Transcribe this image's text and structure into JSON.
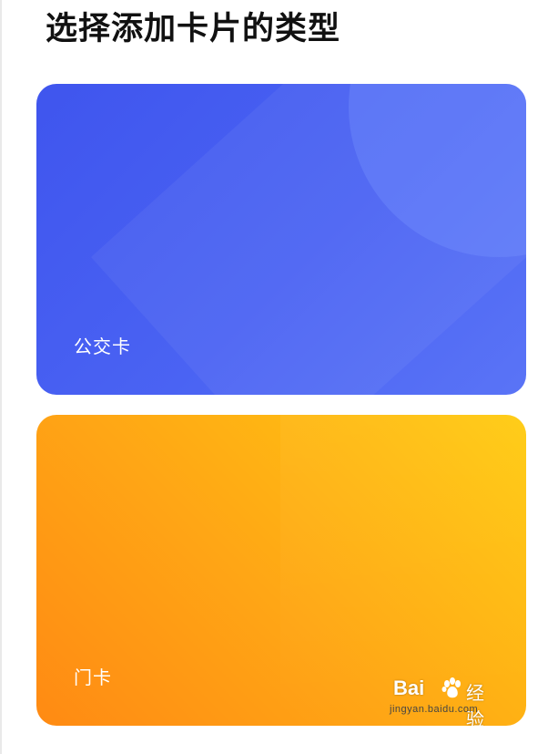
{
  "page": {
    "title": "选择添加卡片的类型"
  },
  "cards": [
    {
      "id": "transit",
      "label": "公交卡",
      "gradient_start": "#3f55ee",
      "gradient_end": "#5a74f6"
    },
    {
      "id": "door",
      "label": "门卡",
      "gradient_start": "#ff8a13",
      "gradient_end": "#ffcb10"
    }
  ],
  "watermark": {
    "brand": "Bai",
    "icon": "baidu-paw-icon",
    "suffix": "经验",
    "url": "jingyan.baidu.com"
  }
}
